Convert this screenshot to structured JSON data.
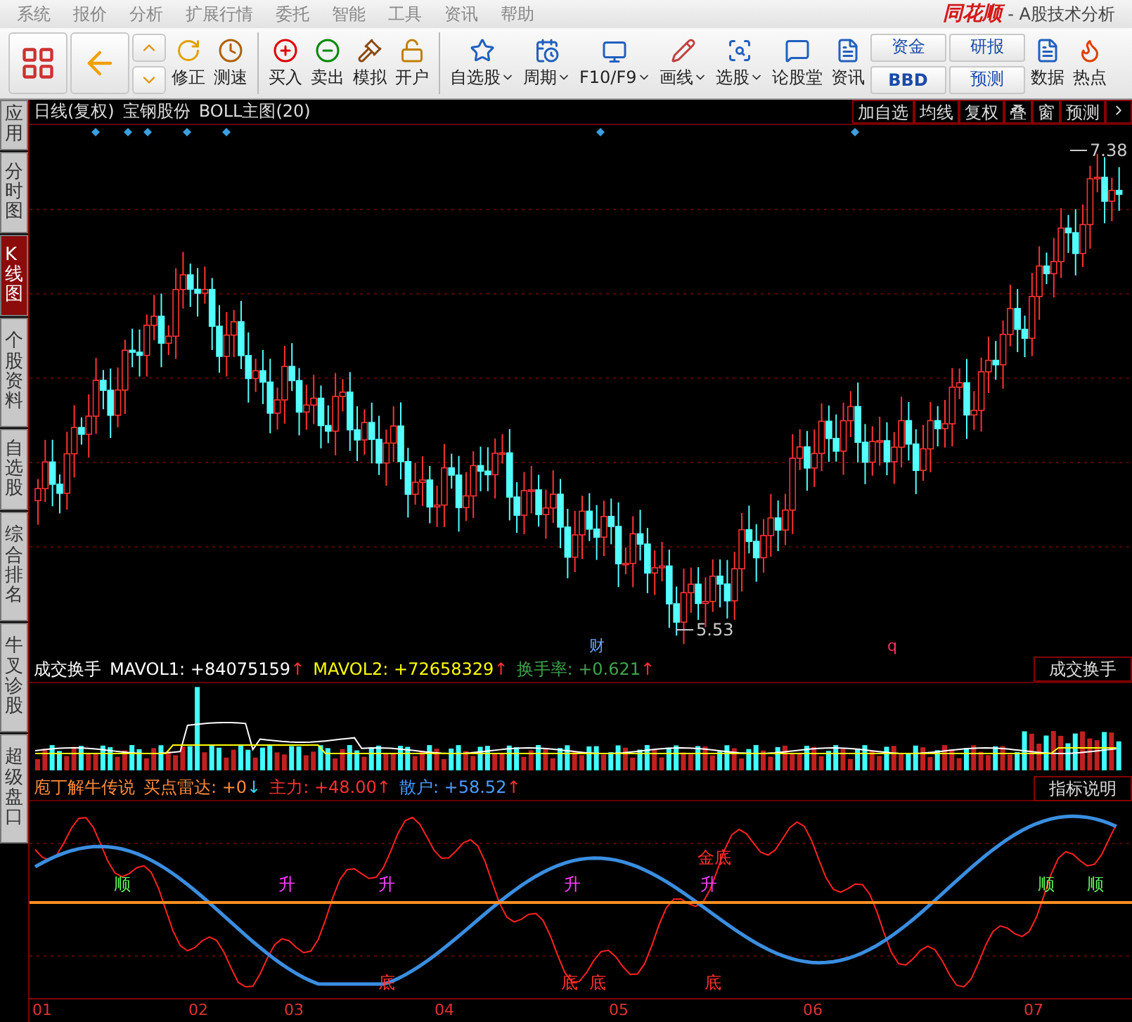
{
  "menu": [
    "系统",
    "报价",
    "分析",
    "扩展行情",
    "委托",
    "智能",
    "工具",
    "资讯",
    "帮助"
  ],
  "app_title": {
    "logo": "同花顺",
    "subtitle": "- A股技术分析"
  },
  "toolbar": [
    {
      "kind": "single",
      "label": "修正"
    },
    {
      "kind": "single",
      "label": "测速"
    },
    {
      "kind": "single",
      "label": "买入"
    },
    {
      "kind": "single",
      "label": "卖出"
    },
    {
      "kind": "single",
      "label": "模拟"
    },
    {
      "kind": "single",
      "label": "开户"
    },
    {
      "kind": "dropdown",
      "label": "自选股"
    },
    {
      "kind": "dropdown",
      "label": "周期"
    },
    {
      "kind": "dropdown",
      "label": "F10/F9"
    },
    {
      "kind": "dropdown",
      "label": "画线"
    },
    {
      "kind": "dropdown",
      "label": "选股"
    },
    {
      "kind": "single",
      "label": "论股堂"
    },
    {
      "kind": "single",
      "label": "资讯"
    },
    {
      "kind": "pair",
      "labels": [
        "资金",
        "BBD"
      ]
    },
    {
      "kind": "pair",
      "labels": [
        "研报",
        "预测"
      ]
    },
    {
      "kind": "single",
      "label": "数据"
    },
    {
      "kind": "single",
      "label": "热点"
    }
  ],
  "sidebar": [
    {
      "label": "应用",
      "selected": false
    },
    {
      "label": "分时图",
      "selected": false
    },
    {
      "label": "K线图",
      "selected": true
    },
    {
      "label": "个股资料",
      "selected": false
    },
    {
      "label": "自选股",
      "selected": false
    },
    {
      "label": "综合排名",
      "selected": false
    },
    {
      "label": "牛叉诊股",
      "selected": false
    },
    {
      "label": "超级盘口",
      "selected": false
    }
  ],
  "chart_header": {
    "title": "日线(复权)",
    "stock": "宝钢股份",
    "indicator": "BOLL主图(20)",
    "buttons": [
      "加自选",
      "均线",
      "复权",
      "叠",
      "窗",
      "预测"
    ]
  },
  "price_chart": {
    "high_label": "7.38",
    "low_label": "5.53",
    "markers": [
      "财",
      "q"
    ]
  },
  "volume_panel": {
    "header": [
      {
        "text": "成交换手",
        "color": "#ffffff"
      },
      {
        "text": "MAVOL1: +84075159",
        "color": "#ffffff",
        "arrow": "↑",
        "rising": true
      },
      {
        "text": "MAVOL2: +72658329",
        "color": "#ffff00",
        "arrow": "↑",
        "rising": true
      },
      {
        "text": "换手率: +0.621",
        "color": "#3fa34d",
        "arrow": "↑",
        "rising": true
      }
    ],
    "button": "成交换手"
  },
  "indicator_panel": {
    "header": [
      {
        "text": "庖丁解牛传说",
        "color": "#ff8c3c"
      },
      {
        "text": "买点雷达: +0",
        "color": "#ff8c3c",
        "arrow": "↓",
        "rising": false
      },
      {
        "text": "主力: +48.00",
        "color": "#ff3030",
        "arrow": "↑",
        "rising": true
      },
      {
        "text": "散户: +58.52",
        "color": "#4a9eff",
        "arrow": "↑",
        "rising": true
      }
    ],
    "button": "指标说明",
    "signals": [
      {
        "text": "金底",
        "kind": "bottom"
      },
      {
        "text": "顺",
        "kind": "buy"
      },
      {
        "text": "升",
        "kind": "rise"
      },
      {
        "text": "升",
        "kind": "rise"
      },
      {
        "text": "升",
        "kind": "rise"
      },
      {
        "text": "升",
        "kind": "rise"
      },
      {
        "text": "顺",
        "kind": "buy"
      },
      {
        "text": "顺",
        "kind": "buy"
      },
      {
        "text": "底",
        "kind": "bottom"
      },
      {
        "text": "底",
        "kind": "bottom"
      },
      {
        "text": "底",
        "kind": "bottom"
      },
      {
        "text": "底",
        "kind": "bottom"
      }
    ]
  },
  "months": [
    "01",
    "02",
    "03",
    "04",
    "05",
    "06",
    "07"
  ]
}
